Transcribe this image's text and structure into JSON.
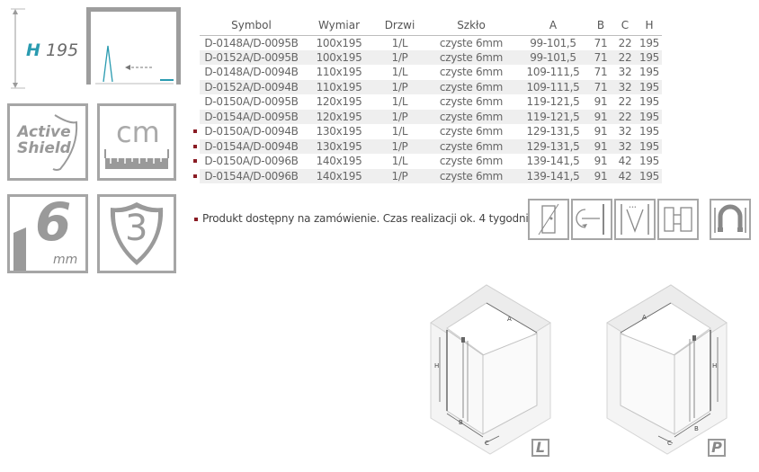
{
  "height_badge": {
    "letter": "H",
    "value": "195"
  },
  "features": {
    "active_shield_line1": "Active",
    "active_shield_line2": "Shield",
    "cm_label": "cm",
    "glass_thickness": "6",
    "glass_unit": "mm",
    "warranty_years": "3"
  },
  "table": {
    "headers": [
      "Symbol",
      "Wymiar",
      "Drzwi",
      "Szkło",
      "A",
      "B",
      "C",
      "H"
    ],
    "rows": [
      {
        "symbol": "D-0148A/D-0095B",
        "size": "100x195",
        "door": "1/L",
        "glass": "czyste 6mm",
        "a": "99-101,5",
        "b": "71",
        "c": "22",
        "h": "195",
        "on_order": false
      },
      {
        "symbol": "D-0152A/D-0095B",
        "size": "100x195",
        "door": "1/P",
        "glass": "czyste 6mm",
        "a": "99-101,5",
        "b": "71",
        "c": "22",
        "h": "195",
        "on_order": false
      },
      {
        "symbol": "D-0148A/D-0094B",
        "size": "110x195",
        "door": "1/L",
        "glass": "czyste 6mm",
        "a": "109-111,5",
        "b": "71",
        "c": "32",
        "h": "195",
        "on_order": false
      },
      {
        "symbol": "D-0152A/D-0094B",
        "size": "110x195",
        "door": "1/P",
        "glass": "czyste 6mm",
        "a": "109-111,5",
        "b": "71",
        "c": "32",
        "h": "195",
        "on_order": false
      },
      {
        "symbol": "D-0150A/D-0095B",
        "size": "120x195",
        "door": "1/L",
        "glass": "czyste 6mm",
        "a": "119-121,5",
        "b": "91",
        "c": "22",
        "h": "195",
        "on_order": false
      },
      {
        "symbol": "D-0154A/D-0095B",
        "size": "120x195",
        "door": "1/P",
        "glass": "czyste 6mm",
        "a": "119-121,5",
        "b": "91",
        "c": "22",
        "h": "195",
        "on_order": false
      },
      {
        "symbol": "D-0150A/D-0094B",
        "size": "130x195",
        "door": "1/L",
        "glass": "czyste 6mm",
        "a": "129-131,5",
        "b": "91",
        "c": "32",
        "h": "195",
        "on_order": true
      },
      {
        "symbol": "D-0154A/D-0094B",
        "size": "130x195",
        "door": "1/P",
        "glass": "czyste 6mm",
        "a": "129-131,5",
        "b": "91",
        "c": "32",
        "h": "195",
        "on_order": true
      },
      {
        "symbol": "D-0150A/D-0096B",
        "size": "140x195",
        "door": "1/L",
        "glass": "czyste 6mm",
        "a": "139-141,5",
        "b": "91",
        "c": "42",
        "h": "195",
        "on_order": true
      },
      {
        "symbol": "D-0154A/D-0096B",
        "size": "140x195",
        "door": "1/P",
        "glass": "czyste 6mm",
        "a": "139-141,5",
        "b": "91",
        "c": "42",
        "h": "195",
        "on_order": true
      }
    ]
  },
  "note": "Produkt dostępny na zamówienie. Czas realizacji ok. 4 tygodni",
  "diagram_labels": {
    "a": "A",
    "b": "B",
    "c": "C",
    "h": "H"
  },
  "variant_left": "L",
  "variant_right": "P",
  "colors": {
    "accent": "#2a9bb0",
    "order_marker": "#8a1c24",
    "icon_gray": "#9d9d9d"
  }
}
